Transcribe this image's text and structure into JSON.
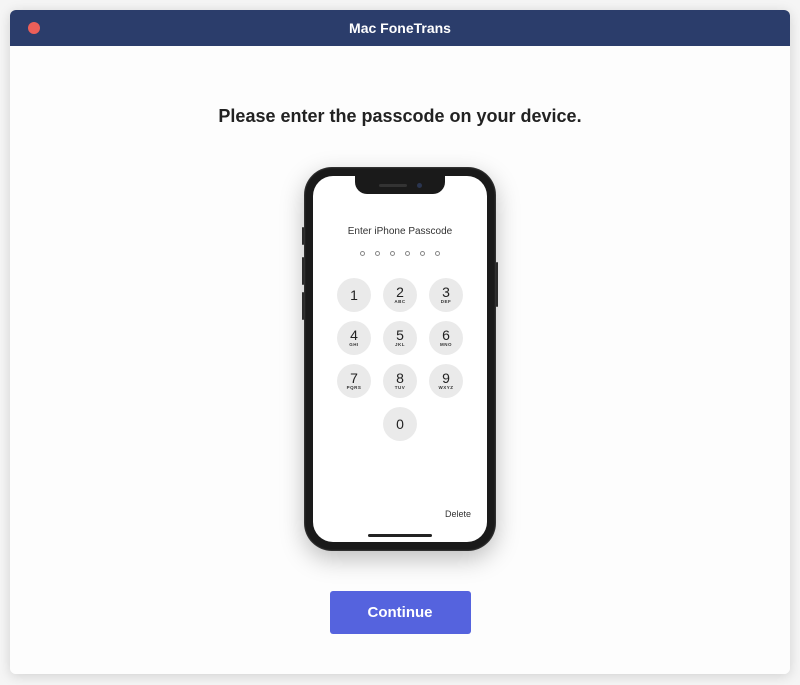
{
  "window": {
    "title": "Mac FoneTrans"
  },
  "main": {
    "instruction": "Please enter the passcode on your device.",
    "continue_label": "Continue"
  },
  "phone": {
    "passcode_title": "Enter iPhone Passcode",
    "delete_label": "Delete",
    "passcode_dots": 6,
    "keys": [
      {
        "num": "1",
        "letters": ""
      },
      {
        "num": "2",
        "letters": "ABC"
      },
      {
        "num": "3",
        "letters": "DEF"
      },
      {
        "num": "4",
        "letters": "GHI"
      },
      {
        "num": "5",
        "letters": "JKL"
      },
      {
        "num": "6",
        "letters": "MNO"
      },
      {
        "num": "7",
        "letters": "PQRS"
      },
      {
        "num": "8",
        "letters": "TUV"
      },
      {
        "num": "9",
        "letters": "WXYZ"
      },
      {
        "num": "0",
        "letters": ""
      }
    ]
  }
}
